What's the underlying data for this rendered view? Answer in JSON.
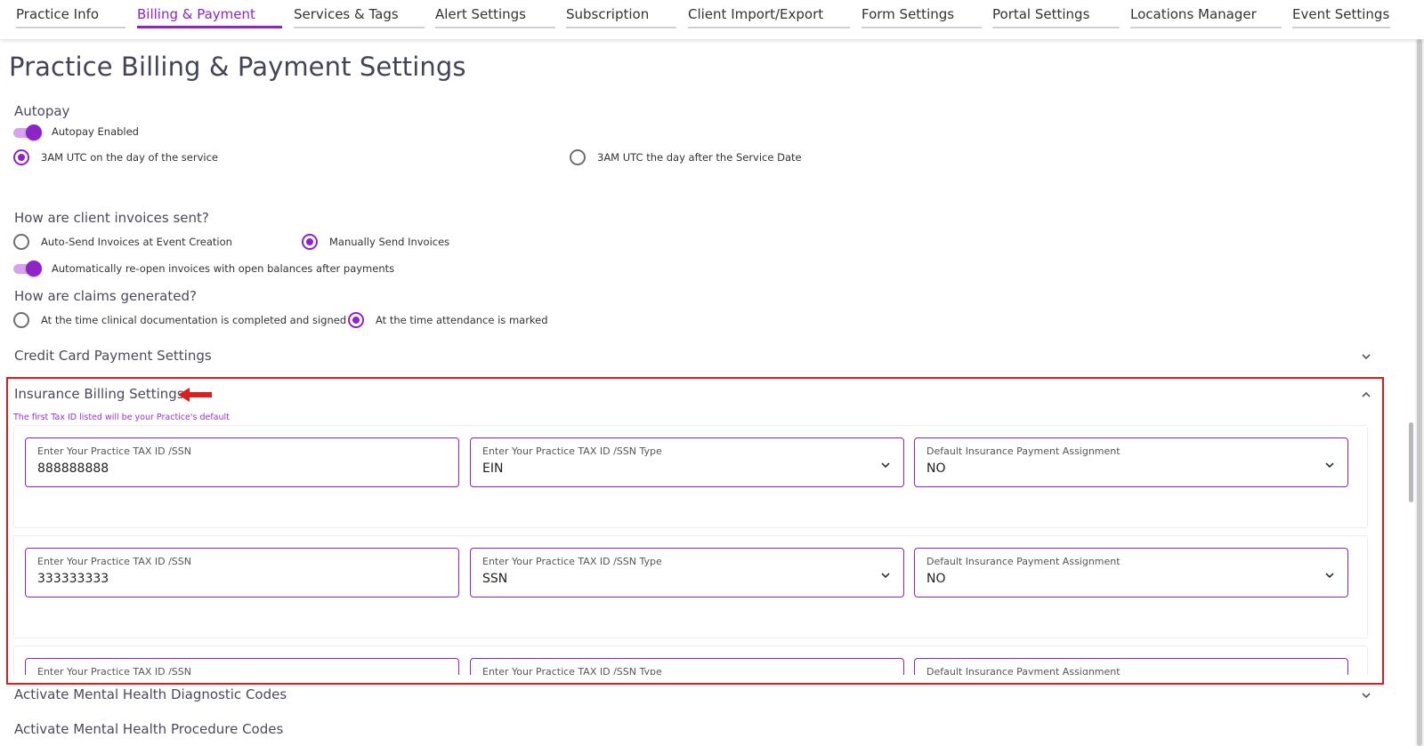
{
  "tabs": [
    {
      "label": "Practice Info",
      "active": false
    },
    {
      "label": "Billing & Payment",
      "active": true
    },
    {
      "label": "Services & Tags",
      "active": false
    },
    {
      "label": "Alert Settings",
      "active": false
    },
    {
      "label": "Subscription",
      "active": false
    },
    {
      "label": "Client Import/Export",
      "active": false
    },
    {
      "label": "Form Settings",
      "active": false
    },
    {
      "label": "Portal Settings",
      "active": false
    },
    {
      "label": "Locations Manager",
      "active": false
    },
    {
      "label": "Event Settings",
      "active": false
    }
  ],
  "page_title": "Practice Billing & Payment Settings",
  "autopay": {
    "heading": "Autopay",
    "toggle_label": "Autopay Enabled",
    "toggle_on": true,
    "options": [
      {
        "label": "3AM UTC on the day of the service",
        "selected": true
      },
      {
        "label": "3AM UTC the day after the Service Date",
        "selected": false
      }
    ]
  },
  "invoices": {
    "heading": "How are client invoices sent?",
    "options": [
      {
        "label": "Auto-Send Invoices at Event Creation",
        "selected": false
      },
      {
        "label": "Manually Send Invoices",
        "selected": true
      }
    ],
    "reopen_toggle_label": "Automatically re-open invoices with open balances after payments",
    "reopen_toggle_on": true
  },
  "claims": {
    "heading": "How are claims generated?",
    "options": [
      {
        "label": "At the time clinical documentation is completed and signed",
        "selected": false
      },
      {
        "label": "At the time attendance is marked",
        "selected": true
      }
    ]
  },
  "sections": {
    "credit_card": "Credit Card Payment Settings",
    "insurance": "Insurance Billing Settings",
    "mental_health_diag": "Activate Mental Health Diagnostic Codes",
    "mental_health_proc": "Activate Mental Health Procedure Codes"
  },
  "insurance": {
    "hint": "The first Tax ID listed will be your Practice's default",
    "field_labels": {
      "tax_id": "Enter Your Practice TAX ID /SSN",
      "tax_type": "Enter Your Practice TAX ID /SSN Type",
      "assignment": "Default Insurance Payment Assignment"
    },
    "rows": [
      {
        "tax_id": "888888888",
        "tax_type": "EIN",
        "assignment": "NO"
      },
      {
        "tax_id": "333333333",
        "tax_type": "SSN",
        "assignment": "NO"
      },
      {
        "tax_id": "",
        "tax_type": "",
        "assignment": ""
      }
    ]
  },
  "colors": {
    "accent": "#8e24c8",
    "highlight": "#e01b1b"
  }
}
